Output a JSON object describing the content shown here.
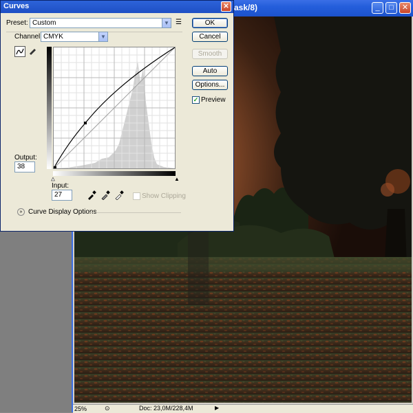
{
  "document_window": {
    "title_fragment": "ask/8)",
    "minimize_glyph": "_",
    "maximize_glyph": "□",
    "close_glyph": "✕",
    "zoom": "25%",
    "doc_info": "Doc: 23,0M/228,4M",
    "nav_arrow": "▶"
  },
  "curves": {
    "title": "Curves",
    "close_glyph": "✕",
    "preset_label": "Preset:",
    "preset_value": "Custom",
    "channel_label": "Channel:",
    "channel_value": "CMYK",
    "ok_label": "OK",
    "cancel_label": "Cancel",
    "smooth_label": "Smooth",
    "auto_label": "Auto",
    "options_label": "Options...",
    "preview_label": "Preview",
    "preview_checked": true,
    "output_label": "Output:",
    "output_value": "38",
    "input_label": "Input:",
    "input_value": "27",
    "show_clipping_label": "Show Clipping",
    "show_clipping_checked": false,
    "curve_display_options_label": "Curve Display Options",
    "preset_menu_icon": "preset-menu-icon",
    "curve_tool_icon": "curve-tool-icon",
    "pencil_tool_icon": "pencil-icon",
    "eyedropper_icons": [
      "black-eyedropper-icon",
      "gray-eyedropper-icon",
      "white-eyedropper-icon"
    ]
  }
}
